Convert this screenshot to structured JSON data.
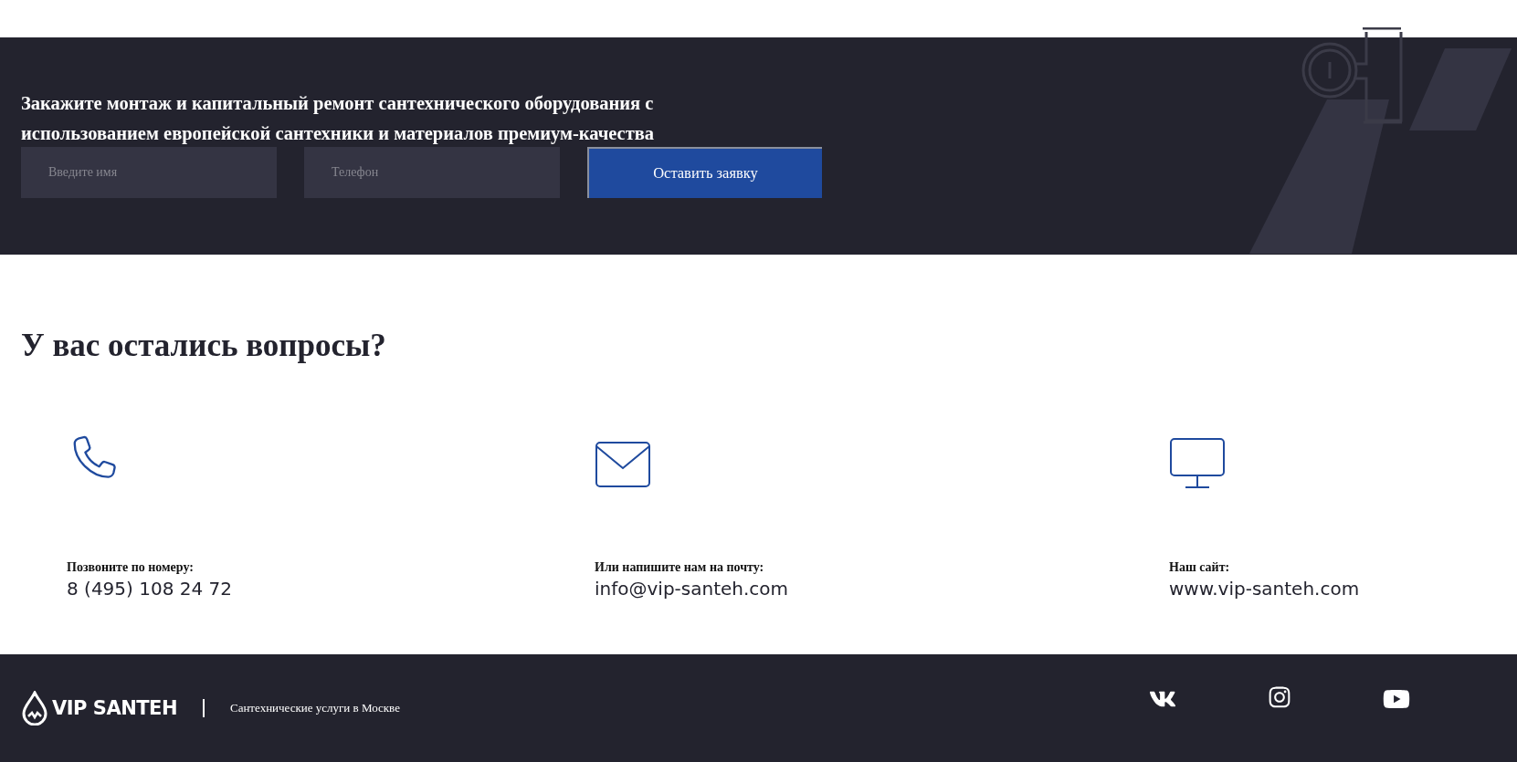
{
  "order_banner": {
    "heading": "Закажите монтаж и капитальный ремонт сантехнического оборудования с использованием европейской сантехники и материалов премиум-качества",
    "fields": [
      {
        "placeholder": "Введите имя"
      },
      {
        "placeholder": "Телефон"
      }
    ],
    "submit_button": "Оставить заявку"
  },
  "contacts": {
    "heading": "У вас остались вопросы?",
    "items": [
      {
        "kind": "phone",
        "label": "Позвоните по номеру:",
        "value": "8 (495) 108 24 72"
      },
      {
        "kind": "email",
        "label": "Или напишите нам на почту:",
        "value": "info@vip-santeh.com"
      },
      {
        "kind": "website",
        "label": "Наш сайт:",
        "value": "www.vip-santeh.com"
      }
    ]
  },
  "footer": {
    "logo": "VIP SANTEH",
    "tagline": "Сантехнические услуги в Москве",
    "social": [
      {
        "kind": "vk"
      },
      {
        "kind": "instagram"
      },
      {
        "kind": "youtube"
      }
    ]
  }
}
